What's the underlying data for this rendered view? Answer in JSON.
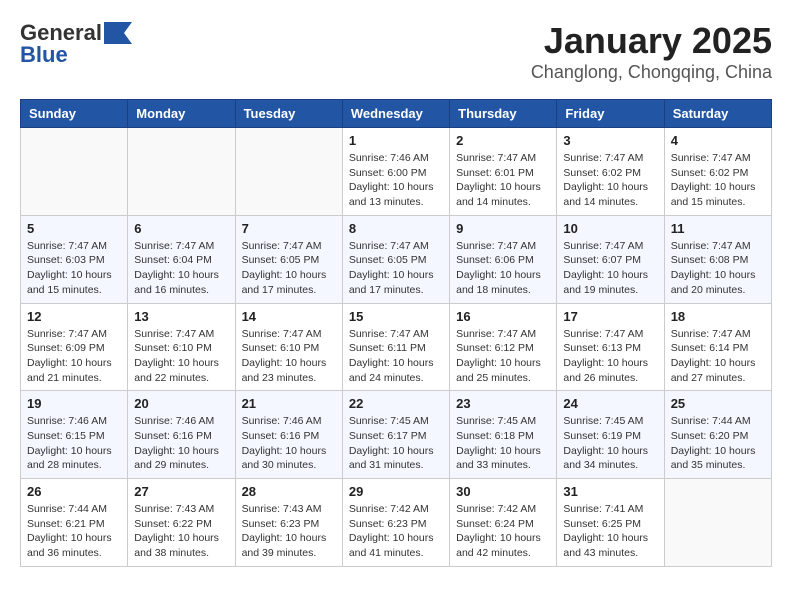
{
  "header": {
    "logo_line1": "General",
    "logo_line2": "Blue",
    "title": "January 2025",
    "subtitle": "Changlong, Chongqing, China"
  },
  "days_of_week": [
    "Sunday",
    "Monday",
    "Tuesday",
    "Wednesday",
    "Thursday",
    "Friday",
    "Saturday"
  ],
  "weeks": [
    [
      {
        "day": "",
        "info": ""
      },
      {
        "day": "",
        "info": ""
      },
      {
        "day": "",
        "info": ""
      },
      {
        "day": "1",
        "info": "Sunrise: 7:46 AM\nSunset: 6:00 PM\nDaylight: 10 hours\nand 13 minutes."
      },
      {
        "day": "2",
        "info": "Sunrise: 7:47 AM\nSunset: 6:01 PM\nDaylight: 10 hours\nand 14 minutes."
      },
      {
        "day": "3",
        "info": "Sunrise: 7:47 AM\nSunset: 6:02 PM\nDaylight: 10 hours\nand 14 minutes."
      },
      {
        "day": "4",
        "info": "Sunrise: 7:47 AM\nSunset: 6:02 PM\nDaylight: 10 hours\nand 15 minutes."
      }
    ],
    [
      {
        "day": "5",
        "info": "Sunrise: 7:47 AM\nSunset: 6:03 PM\nDaylight: 10 hours\nand 15 minutes."
      },
      {
        "day": "6",
        "info": "Sunrise: 7:47 AM\nSunset: 6:04 PM\nDaylight: 10 hours\nand 16 minutes."
      },
      {
        "day": "7",
        "info": "Sunrise: 7:47 AM\nSunset: 6:05 PM\nDaylight: 10 hours\nand 17 minutes."
      },
      {
        "day": "8",
        "info": "Sunrise: 7:47 AM\nSunset: 6:05 PM\nDaylight: 10 hours\nand 17 minutes."
      },
      {
        "day": "9",
        "info": "Sunrise: 7:47 AM\nSunset: 6:06 PM\nDaylight: 10 hours\nand 18 minutes."
      },
      {
        "day": "10",
        "info": "Sunrise: 7:47 AM\nSunset: 6:07 PM\nDaylight: 10 hours\nand 19 minutes."
      },
      {
        "day": "11",
        "info": "Sunrise: 7:47 AM\nSunset: 6:08 PM\nDaylight: 10 hours\nand 20 minutes."
      }
    ],
    [
      {
        "day": "12",
        "info": "Sunrise: 7:47 AM\nSunset: 6:09 PM\nDaylight: 10 hours\nand 21 minutes."
      },
      {
        "day": "13",
        "info": "Sunrise: 7:47 AM\nSunset: 6:10 PM\nDaylight: 10 hours\nand 22 minutes."
      },
      {
        "day": "14",
        "info": "Sunrise: 7:47 AM\nSunset: 6:10 PM\nDaylight: 10 hours\nand 23 minutes."
      },
      {
        "day": "15",
        "info": "Sunrise: 7:47 AM\nSunset: 6:11 PM\nDaylight: 10 hours\nand 24 minutes."
      },
      {
        "day": "16",
        "info": "Sunrise: 7:47 AM\nSunset: 6:12 PM\nDaylight: 10 hours\nand 25 minutes."
      },
      {
        "day": "17",
        "info": "Sunrise: 7:47 AM\nSunset: 6:13 PM\nDaylight: 10 hours\nand 26 minutes."
      },
      {
        "day": "18",
        "info": "Sunrise: 7:47 AM\nSunset: 6:14 PM\nDaylight: 10 hours\nand 27 minutes."
      }
    ],
    [
      {
        "day": "19",
        "info": "Sunrise: 7:46 AM\nSunset: 6:15 PM\nDaylight: 10 hours\nand 28 minutes."
      },
      {
        "day": "20",
        "info": "Sunrise: 7:46 AM\nSunset: 6:16 PM\nDaylight: 10 hours\nand 29 minutes."
      },
      {
        "day": "21",
        "info": "Sunrise: 7:46 AM\nSunset: 6:16 PM\nDaylight: 10 hours\nand 30 minutes."
      },
      {
        "day": "22",
        "info": "Sunrise: 7:45 AM\nSunset: 6:17 PM\nDaylight: 10 hours\nand 31 minutes."
      },
      {
        "day": "23",
        "info": "Sunrise: 7:45 AM\nSunset: 6:18 PM\nDaylight: 10 hours\nand 33 minutes."
      },
      {
        "day": "24",
        "info": "Sunrise: 7:45 AM\nSunset: 6:19 PM\nDaylight: 10 hours\nand 34 minutes."
      },
      {
        "day": "25",
        "info": "Sunrise: 7:44 AM\nSunset: 6:20 PM\nDaylight: 10 hours\nand 35 minutes."
      }
    ],
    [
      {
        "day": "26",
        "info": "Sunrise: 7:44 AM\nSunset: 6:21 PM\nDaylight: 10 hours\nand 36 minutes."
      },
      {
        "day": "27",
        "info": "Sunrise: 7:43 AM\nSunset: 6:22 PM\nDaylight: 10 hours\nand 38 minutes."
      },
      {
        "day": "28",
        "info": "Sunrise: 7:43 AM\nSunset: 6:23 PM\nDaylight: 10 hours\nand 39 minutes."
      },
      {
        "day": "29",
        "info": "Sunrise: 7:42 AM\nSunset: 6:23 PM\nDaylight: 10 hours\nand 41 minutes."
      },
      {
        "day": "30",
        "info": "Sunrise: 7:42 AM\nSunset: 6:24 PM\nDaylight: 10 hours\nand 42 minutes."
      },
      {
        "day": "31",
        "info": "Sunrise: 7:41 AM\nSunset: 6:25 PM\nDaylight: 10 hours\nand 43 minutes."
      },
      {
        "day": "",
        "info": ""
      }
    ]
  ]
}
